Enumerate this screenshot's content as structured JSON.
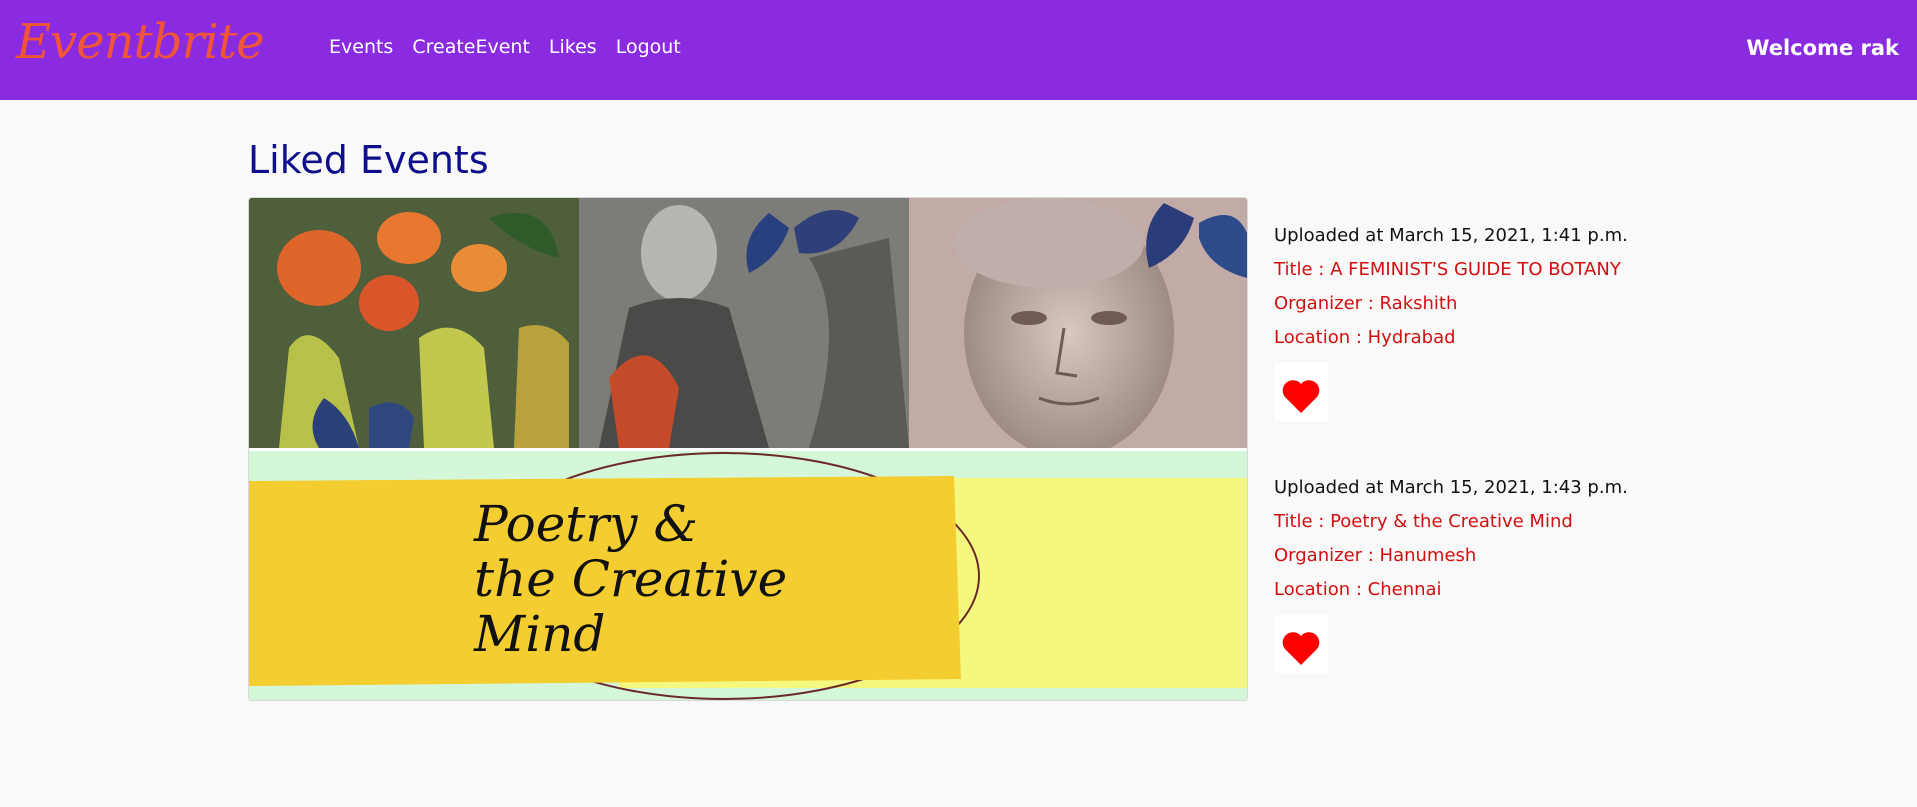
{
  "navbar": {
    "brand": "Eventbrite",
    "links": [
      {
        "label": "Events"
      },
      {
        "label": "CreateEvent"
      },
      {
        "label": "Likes"
      },
      {
        "label": "Logout"
      }
    ],
    "welcome": "Welcome rak",
    "background_color": "#8a2be2",
    "brand_color": "#f05537"
  },
  "page": {
    "title": "Liked Events",
    "title_color": "#0f0f8c"
  },
  "events": [
    {
      "image_text": "",
      "uploaded": "Uploaded at March 15, 2021, 1:41 p.m.",
      "title": "Title : A FEMINIST'S GUIDE TO BOTANY",
      "organizer": "Organizer : Rakshith",
      "location": "Location : Hydrabad",
      "like_icon": "heart-icon"
    },
    {
      "image_text": [
        "Poetry &",
        "the Creative",
        "Mind"
      ],
      "uploaded": "Uploaded at March 15, 2021, 1:43 p.m.",
      "title": "Title : Poetry & the Creative Mind",
      "organizer": "Organizer : Hanumesh",
      "location": "Location : Chennai",
      "like_icon": "heart-icon"
    }
  ],
  "colors": {
    "field_text": "#d20f0f",
    "heart": "#ff0000"
  }
}
